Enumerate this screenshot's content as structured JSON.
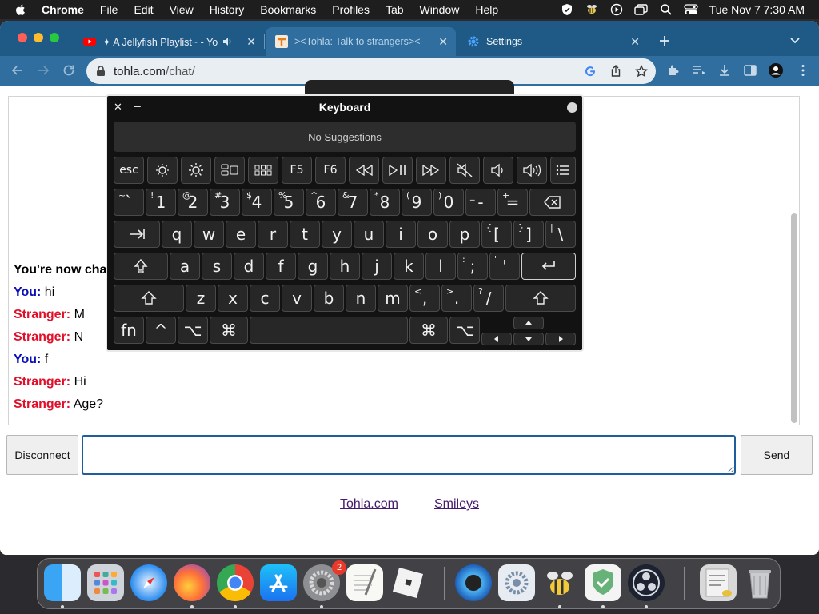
{
  "menubar": {
    "app": "Chrome",
    "items": [
      "File",
      "Edit",
      "View",
      "History",
      "Bookmarks",
      "Profiles",
      "Tab",
      "Window",
      "Help"
    ],
    "clock": "Tue Nov 7  7:30 AM"
  },
  "tabs": [
    {
      "title": "✦ A Jellyfish Playlist~ - Yo"
    },
    {
      "title": "><Tohla: Talk to strangers><"
    },
    {
      "title": "Settings"
    }
  ],
  "address": {
    "domain": "tohla.com",
    "path": "/chat/"
  },
  "chat": {
    "connected_text": "You're now cha",
    "messages": [
      {
        "who": "You:",
        "role": "you",
        "text": " hi"
      },
      {
        "who": "Stranger:",
        "role": "stranger",
        "text": " M"
      },
      {
        "who": "Stranger:",
        "role": "stranger",
        "text": " N"
      },
      {
        "who": "You:",
        "role": "you",
        "text": " f"
      },
      {
        "who": "Stranger:",
        "role": "stranger",
        "text": " Hi"
      },
      {
        "who": "Stranger:",
        "role": "stranger",
        "text": " Age?"
      }
    ]
  },
  "controls": {
    "disconnect": "Disconnect",
    "send": "Send",
    "message_value": ""
  },
  "footer": {
    "link1": "Tohla.com",
    "link2": "Smileys"
  },
  "keyboard": {
    "title": "Keyboard",
    "suggestions": "No Suggestions",
    "fn_row": [
      "esc",
      "F5",
      "F6"
    ],
    "row1": [
      [
        "~",
        "`"
      ],
      [
        "!",
        "1"
      ],
      [
        "@",
        "2"
      ],
      [
        "#",
        "3"
      ],
      [
        "$",
        "4"
      ],
      [
        "%",
        "5"
      ],
      [
        "^",
        "6"
      ],
      [
        "&",
        "7"
      ],
      [
        "*",
        "8"
      ],
      [
        "(",
        "9"
      ],
      [
        ")",
        "0"
      ],
      [
        "_",
        "-"
      ],
      [
        "+",
        "="
      ]
    ],
    "row2": [
      "q",
      "w",
      "e",
      "r",
      "t",
      "y",
      "u",
      "i",
      "o",
      "p"
    ],
    "row2_brackets": [
      [
        "{",
        "["
      ],
      [
        "}",
        "]"
      ],
      [
        "|",
        "\\"
      ]
    ],
    "row3": [
      "a",
      "s",
      "d",
      "f",
      "g",
      "h",
      "j",
      "k",
      "l"
    ],
    "row3_punct": [
      [
        ":",
        ";"
      ],
      [
        "\"",
        "'"
      ]
    ],
    "row4": [
      "z",
      "x",
      "c",
      "v",
      "b",
      "n",
      "m"
    ],
    "row4_punct": [
      [
        "<",
        ","
      ],
      [
        ">",
        "."
      ],
      [
        "?",
        "/"
      ]
    ],
    "bottom": {
      "fn": "fn",
      "ctrl": "^",
      "opt": "⌥",
      "cmd": "⌘"
    }
  },
  "dock": {
    "settings_badge": "2"
  }
}
